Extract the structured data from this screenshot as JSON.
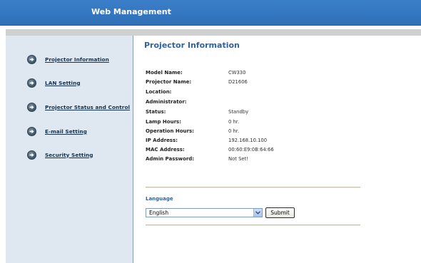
{
  "header": {
    "title": "Web Management"
  },
  "sidebar": {
    "items": [
      {
        "label": "Projector Information",
        "icon": "arrow-right-icon"
      },
      {
        "label": "LAN Setting",
        "icon": "arrow-right-icon"
      },
      {
        "label": "Projector Status and Control",
        "icon": "arrow-right-icon"
      },
      {
        "label": "E-mail Setting",
        "icon": "arrow-right-icon"
      },
      {
        "label": "Security Setting",
        "icon": "arrow-right-icon"
      }
    ]
  },
  "main": {
    "title": "Projector Information",
    "info": [
      {
        "label": "Model Name:",
        "value": "CW330"
      },
      {
        "label": "Projector Name:",
        "value": "D21606"
      },
      {
        "label": "Location:",
        "value": ""
      },
      {
        "label": "Administrator:",
        "value": ""
      },
      {
        "label": "Status:",
        "value": "Standby"
      },
      {
        "label": "Lamp Hours:",
        "value": "0 hr."
      },
      {
        "label": "Operation Hours:",
        "value": "0 hr."
      },
      {
        "label": "IP Address:",
        "value": "192.168.10.100"
      },
      {
        "label": "MAC Address:",
        "value": "00:60:E9:0B:64:66"
      },
      {
        "label": "Admin Password:",
        "value": "Not Set!"
      }
    ],
    "language": {
      "title": "Language",
      "selected": "English",
      "submit_label": "Submit"
    }
  },
  "colors": {
    "header_bg": "#3274c0",
    "sidebar_bg": "#dfe8f0",
    "title_blue": "#2f62a6"
  }
}
